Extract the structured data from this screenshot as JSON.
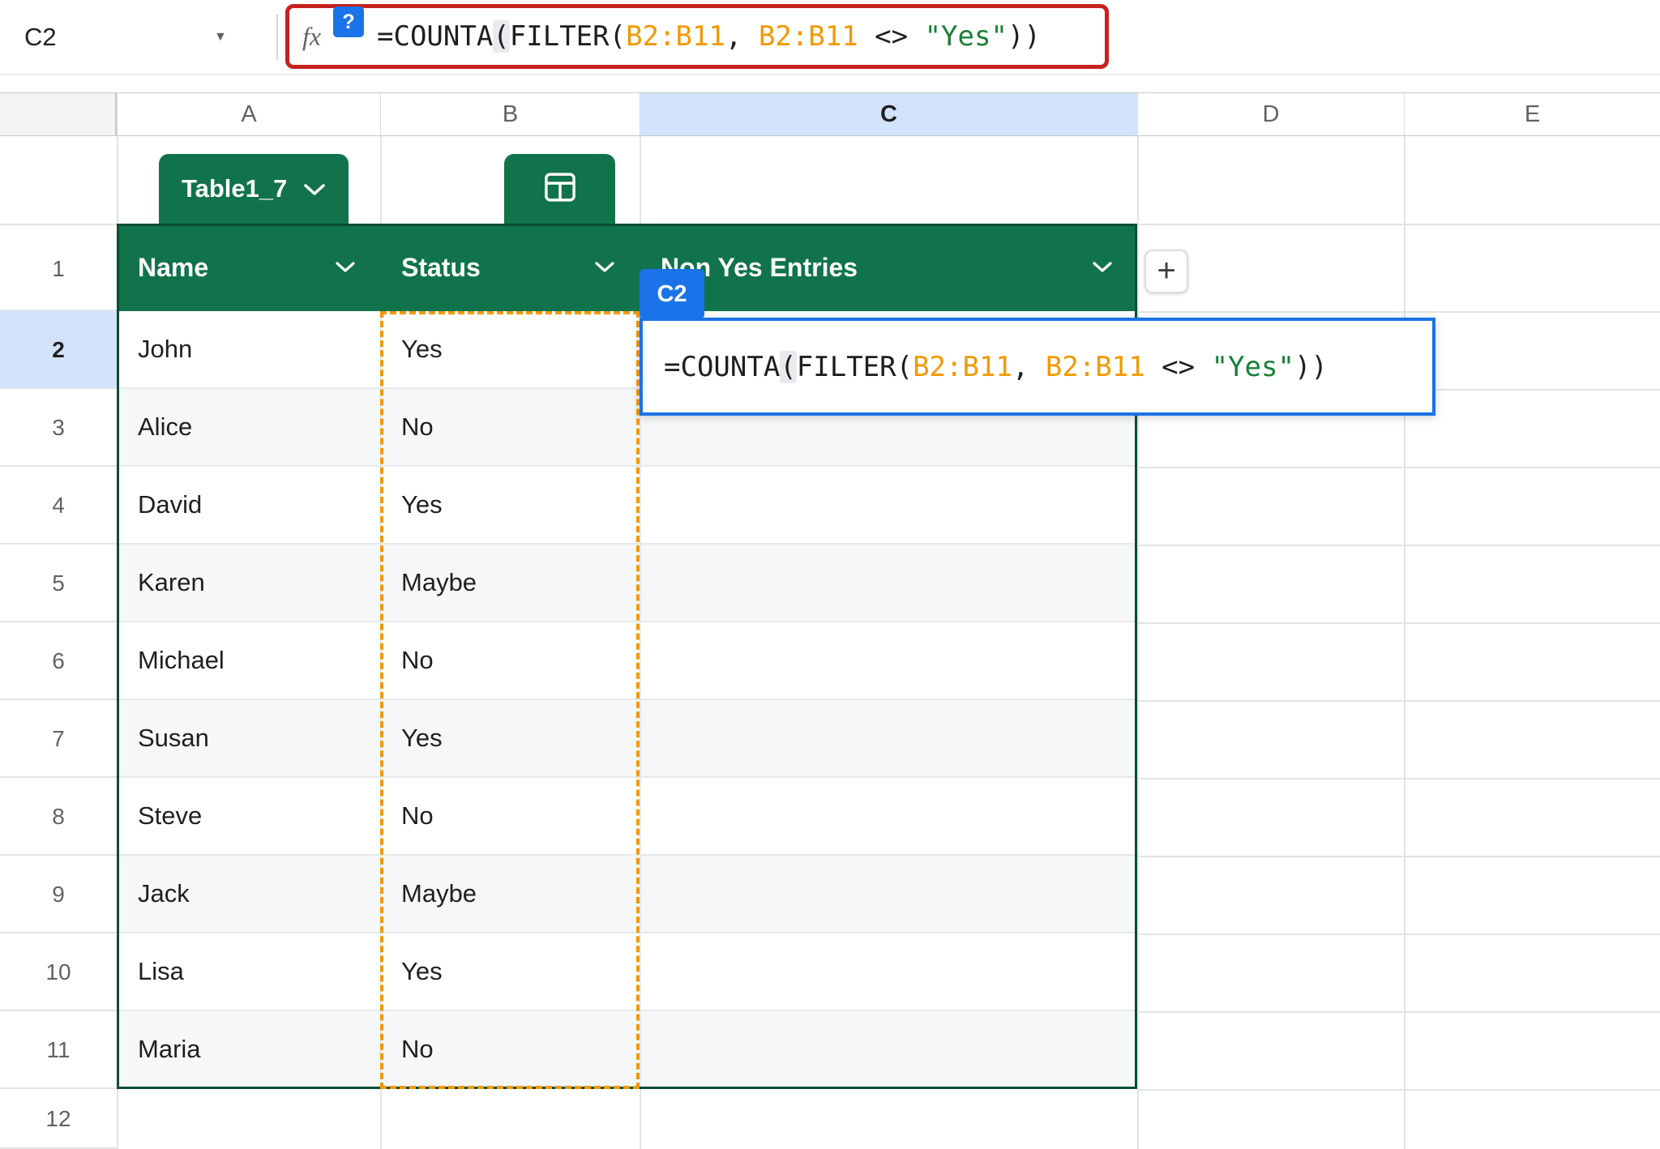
{
  "formula_bar": {
    "cell_reference": "C2",
    "fx_label": "fx",
    "help_badge_label": "?",
    "formula": "=COUNTA(FILTER(B2:B11, B2:B11 <> \"Yes\"))"
  },
  "formula_tokens": [
    {
      "text": "=COUNTA",
      "type": "default"
    },
    {
      "text": "(",
      "type": "paren"
    },
    {
      "text": "FILTER(",
      "type": "default"
    },
    {
      "text": "B2:B11",
      "type": "range"
    },
    {
      "text": ", ",
      "type": "default"
    },
    {
      "text": "B2:B11",
      "type": "range"
    },
    {
      "text": " <> ",
      "type": "default"
    },
    {
      "text": "\"Yes\"",
      "type": "string"
    },
    {
      "text": "))",
      "type": "default"
    }
  ],
  "grid": {
    "column_headers": [
      "A",
      "B",
      "C",
      "D",
      "E"
    ],
    "selected_column": "C",
    "row_headers": [
      "1",
      "2",
      "3",
      "4",
      "5",
      "6",
      "7",
      "8",
      "9",
      "10",
      "11",
      "12"
    ],
    "selected_row": "2"
  },
  "table": {
    "name": "Table1_7",
    "headers": [
      {
        "label": "Name"
      },
      {
        "label": "Status"
      },
      {
        "label": "Non Yes Entries"
      }
    ],
    "add_column_label": "+",
    "rows": [
      {
        "name": "John",
        "status": "Yes"
      },
      {
        "name": "Alice",
        "status": "No"
      },
      {
        "name": "David",
        "status": "Yes"
      },
      {
        "name": "Karen",
        "status": "Maybe"
      },
      {
        "name": "Michael",
        "status": "No"
      },
      {
        "name": "Susan",
        "status": "Yes"
      },
      {
        "name": "Steve",
        "status": "No"
      },
      {
        "name": "Jack",
        "status": "Maybe"
      },
      {
        "name": "Lisa",
        "status": "Yes"
      },
      {
        "name": "Maria",
        "status": "No"
      }
    ]
  },
  "cell_editor": {
    "badge": "C2"
  },
  "colors": {
    "table_green": "#11734b",
    "table_border": "#0a4d32",
    "selection_blue": "#1a73e8",
    "selected_header_bg": "#d3e3fd",
    "range_orange": "#f29900",
    "string_green": "#188038",
    "formula_box_red": "#c5221f"
  }
}
